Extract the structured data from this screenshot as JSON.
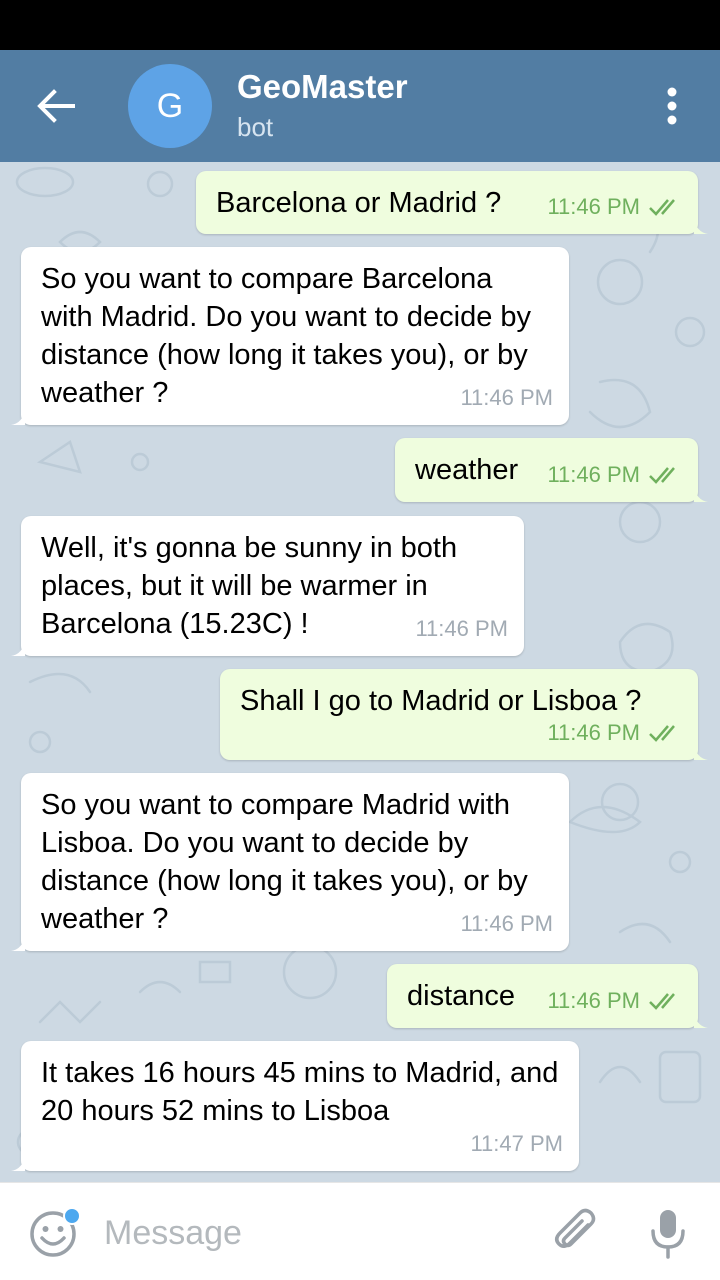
{
  "header": {
    "avatar_letter": "G",
    "title": "GeoMaster",
    "subtitle": "bot",
    "accent_color": "#527da3",
    "avatar_color": "#5ea3e6"
  },
  "messages": [
    {
      "dir": "out",
      "text": "Barcelona or Madrid ?",
      "time": "11:46 PM",
      "status": "read"
    },
    {
      "dir": "in",
      "text": "So you want to compare Barcelona with Madrid. Do you want to decide by distance (how long it takes you), or by weather ?",
      "time": "11:46 PM"
    },
    {
      "dir": "out",
      "text": "weather",
      "time": "11:46 PM",
      "status": "read"
    },
    {
      "dir": "in",
      "text": "Well, it's gonna be sunny in both places, but it will be warmer in Barcelona (15.23C) !",
      "time": "11:46 PM"
    },
    {
      "dir": "out",
      "text": "Shall I go to Madrid or Lisboa ?",
      "time": "11:46 PM",
      "status": "read"
    },
    {
      "dir": "in",
      "text": "So you want to compare Madrid with Lisboa. Do you want to decide by distance (how long it takes you), or by weather ?",
      "time": "11:46 PM"
    },
    {
      "dir": "out",
      "text": "distance",
      "time": "11:46 PM",
      "status": "read"
    },
    {
      "dir": "in",
      "text": "It takes 16 hours 45 mins to Madrid, and 20 hours 52 mins to Lisboa",
      "time": "11:47 PM"
    }
  ],
  "input": {
    "placeholder": "Message",
    "value": ""
  },
  "icons": {
    "back": "arrow-left-icon",
    "menu": "more-vertical-icon",
    "emoji": "smiley-icon",
    "attach": "paperclip-icon",
    "mic": "microphone-icon"
  }
}
